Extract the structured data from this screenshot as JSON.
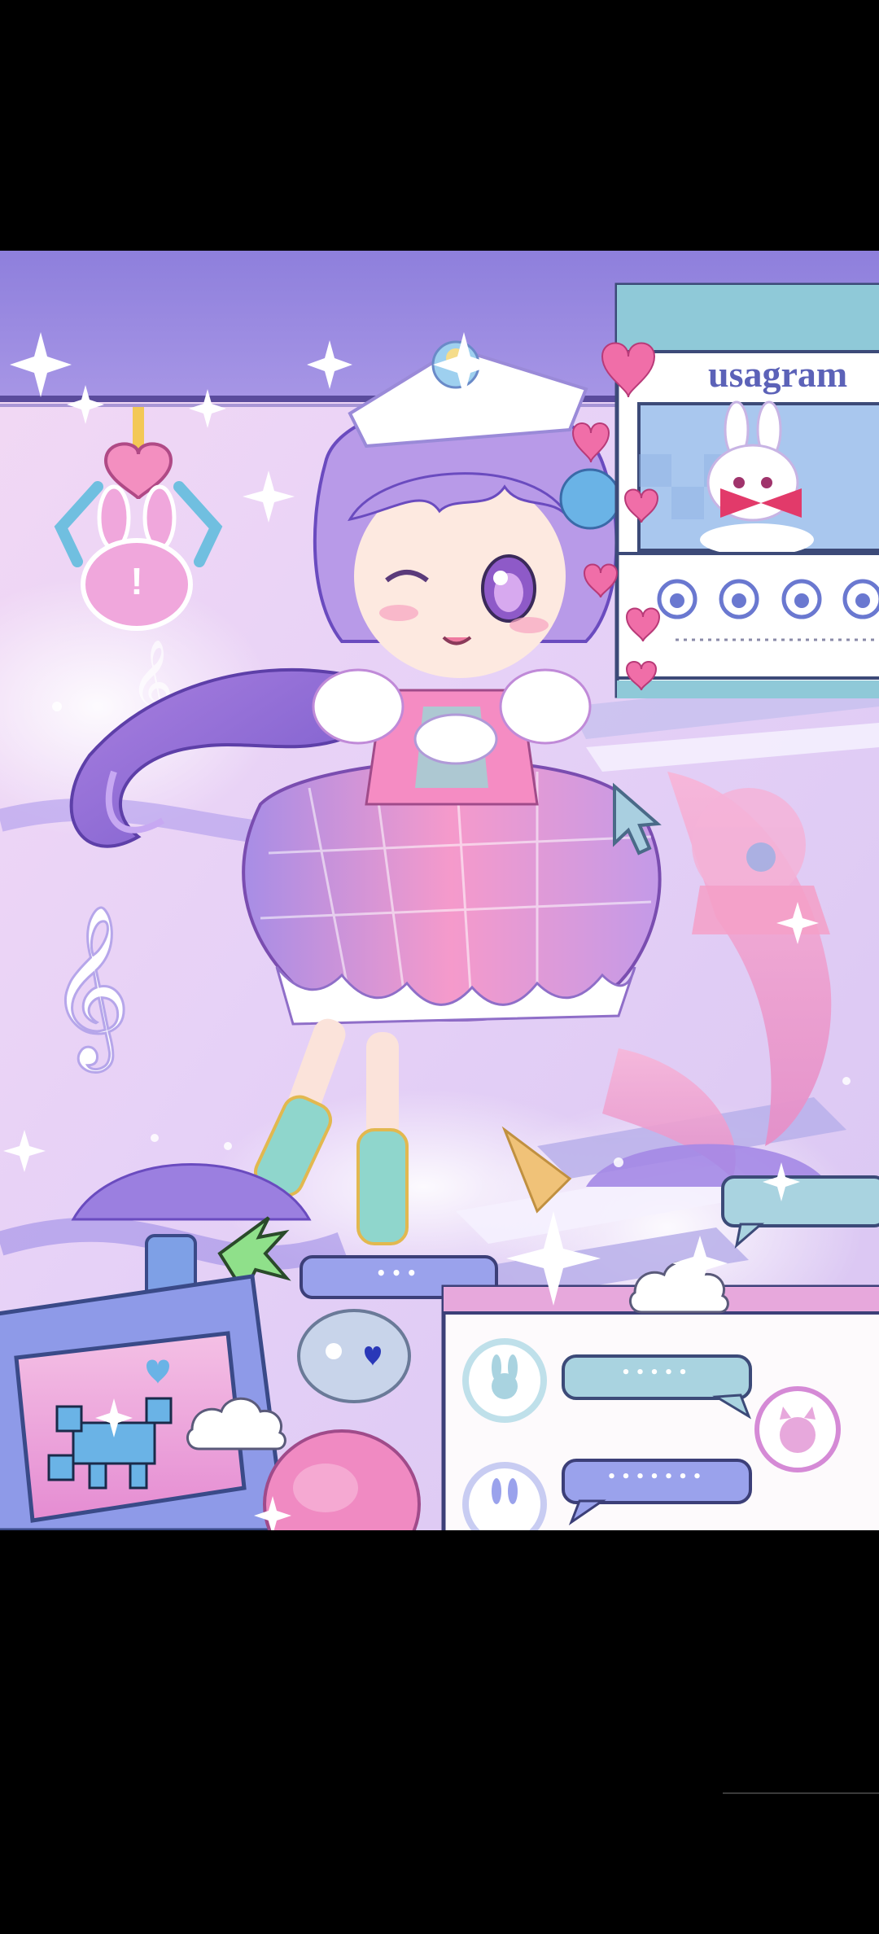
{
  "screen": {
    "usagram_title": "usagram",
    "alert_mark": "!",
    "bubble_left_text": "•••",
    "chat_bubble_1_text": "•••••",
    "chat_bubble_2_text": "•••••••",
    "icons": [
      "bunny-icon",
      "cat-icon",
      "heart-icon",
      "cursor-icon",
      "treble-clef-icon",
      "cloud-icon",
      "sparkle-icon",
      "claw-icon"
    ]
  },
  "colors": {
    "top_band": "#9b8be0",
    "usagram_header": "#8fc9d8",
    "usagram_text": "#5c62b8",
    "chat_panel_header": "#e7a8dc",
    "bubble_blue": "#a9d3e0",
    "bubble_purple": "#9aa2ec",
    "heart_pink": "#f06ea8"
  }
}
